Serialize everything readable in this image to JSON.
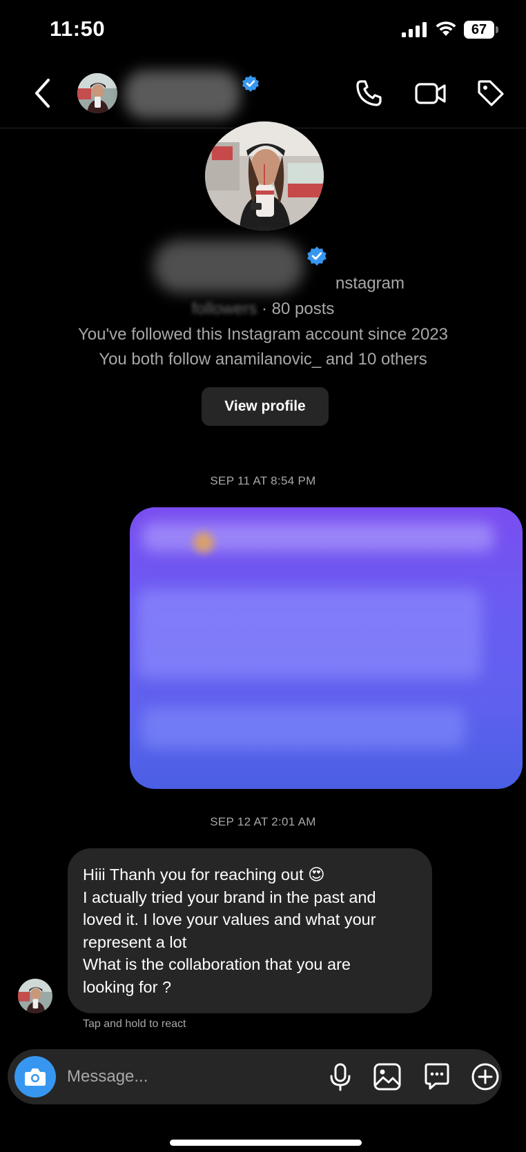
{
  "status_bar": {
    "time": "11:50",
    "battery_level": "67"
  },
  "header": {
    "back_icon": "chevron-left-icon",
    "call_icon": "phone-icon",
    "video_icon": "video-camera-icon",
    "tag_icon": "tag-icon",
    "verified_color": "#3797f0"
  },
  "profile": {
    "username_suffix": "nstagram",
    "followers_suffix": "followers",
    "posts_text": " · 80 posts",
    "followed_since": "You've followed this Instagram account since 2023",
    "mutual_follow": "You both follow anamilanovic_ and 10 others",
    "view_profile_label": "View profile"
  },
  "thread": {
    "timestamp_1": "SEP 11 AT 8:54 PM",
    "timestamp_2": "SEP 12 AT 2:01 AM",
    "incoming_lines": [
      "Hiii Thanh you for reaching out 😍",
      "I actually tried your brand in the past and",
      "loved it. I love your values and what your",
      "represent a lot",
      "What is the collaboration that you are",
      "looking for ?"
    ],
    "react_hint": "Tap and hold to react"
  },
  "composer": {
    "placeholder": "Message...",
    "camera_icon": "camera-icon",
    "mic_icon": "microphone-icon",
    "gallery_icon": "image-icon",
    "sticker_icon": "sticker-chat-icon",
    "plus_icon": "plus-circle-icon",
    "accent_color": "#3797f0"
  },
  "colors": {
    "background": "#000000",
    "bubble_incoming": "#262626",
    "outgoing_gradient_top": "#7a4df0",
    "outgoing_gradient_bottom": "#4a5fe4",
    "secondary_text": "#a8a8a8"
  }
}
